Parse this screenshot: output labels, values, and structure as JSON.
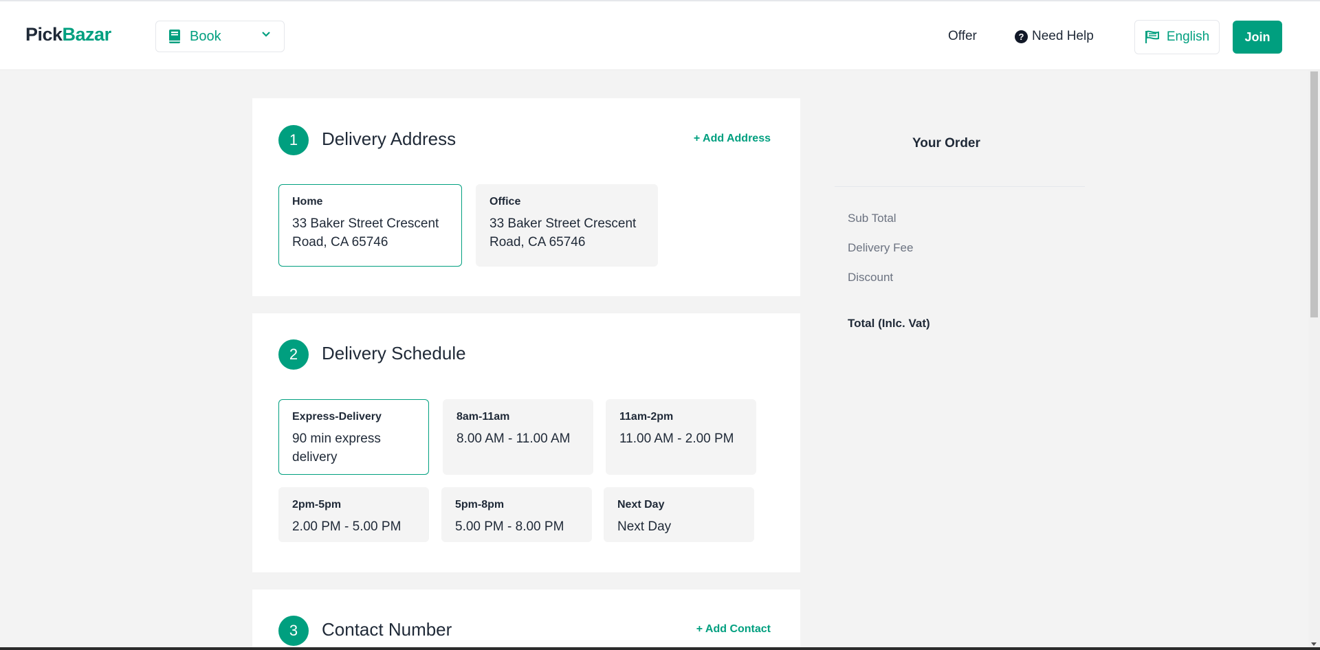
{
  "header": {
    "logo_part1": "Pick",
    "logo_part2": "Bazar",
    "type_select": {
      "selected": "Book"
    },
    "nav": {
      "offer": "Offer",
      "need_help": "Need Help"
    },
    "language": "English",
    "join": "Join"
  },
  "checkout": {
    "delivery_address": {
      "step": "1",
      "title": "Delivery Address",
      "add_link": "+ Add Address",
      "addresses": [
        {
          "title": "Home",
          "detail": "33 Baker Street Crescent Road, CA 65746",
          "selected": true
        },
        {
          "title": "Office",
          "detail": "33 Baker Street Crescent Road, CA 65746",
          "selected": false
        }
      ]
    },
    "delivery_schedule": {
      "step": "2",
      "title": "Delivery Schedule",
      "slots": [
        {
          "title": "Express-Delivery",
          "detail": "90 min express delivery",
          "selected": true
        },
        {
          "title": "8am-11am",
          "detail": "8.00 AM - 11.00 AM",
          "selected": false
        },
        {
          "title": "11am-2pm",
          "detail": "11.00 AM - 2.00 PM",
          "selected": false
        },
        {
          "title": "2pm-5pm",
          "detail": "2.00 PM - 5.00 PM",
          "selected": false
        },
        {
          "title": "5pm-8pm",
          "detail": "5.00 PM - 8.00 PM",
          "selected": false
        },
        {
          "title": "Next Day",
          "detail": "Next Day",
          "selected": false
        }
      ]
    },
    "contact_number": {
      "step": "3",
      "title": "Contact Number",
      "add_link": "+ Add Contact"
    }
  },
  "order": {
    "title": "Your Order",
    "sub_total": "Sub Total",
    "delivery_fee": "Delivery Fee",
    "discount": "Discount",
    "total": "Total (Inlc. Vat)"
  },
  "colors": {
    "accent": "#009f7f",
    "page_bg": "#f3f3f3",
    "card_bg": "#ffffff",
    "option_bg": "#f4f4f4"
  },
  "icons": {
    "type_select": "book-icon",
    "dropdown": "chevron-down-icon",
    "help": "question-circle-icon",
    "language": "flag-icon"
  }
}
